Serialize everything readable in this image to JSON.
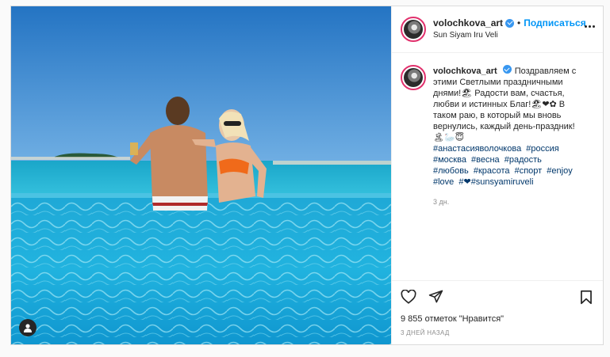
{
  "post": {
    "username": "volochkova_art",
    "follow_separator": "•",
    "follow_label": "Подписаться",
    "location": "Sun Siyam Iru Veli",
    "caption": "Поздравляем с этими Светлыми праздничными днями!🏖 Радости вам, счастья, любви и истинных Благ!🏖❤✿ В таком раю, в который мы вновь вернулись, каждый день-праздник! 🏝🦢😇",
    "hashtags": [
      "#анастасияволочкова",
      "#россия",
      "#москва",
      "#весна",
      "#радость",
      "#любовь",
      "#красота",
      "#спорт",
      "#enjoy",
      "#love",
      "#❤#sunsyamiruveli"
    ],
    "time_ago": "3 дн.",
    "likes_text": "9 855 отметок \"Нравится\"",
    "date_text": "3 ДНЕЙ НАЗАД"
  },
  "icons": {
    "more": "more-options-icon",
    "like": "heart-icon",
    "share": "paper-plane-icon",
    "save": "bookmark-icon",
    "tags": "user-tag-icon",
    "verified": "verified-badge-icon"
  },
  "colors": {
    "accent": "#0095f6",
    "hashtag": "#00376b",
    "verified": "#3897f0",
    "ring": "#e1306c"
  }
}
